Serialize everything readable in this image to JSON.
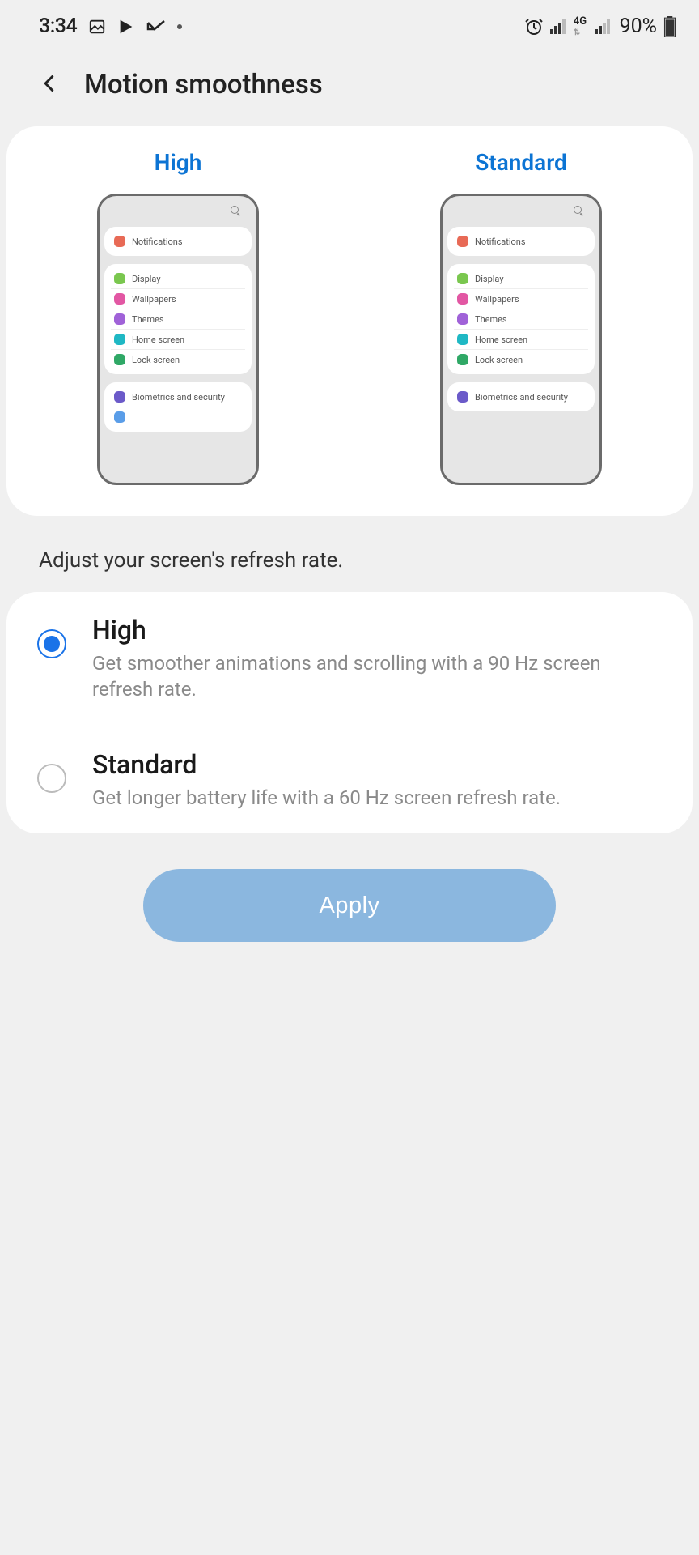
{
  "status": {
    "time": "3:34",
    "network_label": "4G",
    "battery_pct": "90%"
  },
  "header": {
    "title": "Motion smoothness"
  },
  "preview": {
    "high_label": "High",
    "standard_label": "Standard",
    "mock_items": {
      "notifications": "Notifications",
      "display": "Display",
      "wallpapers": "Wallpapers",
      "themes": "Themes",
      "home": "Home screen",
      "lock": "Lock screen",
      "biometrics": "Biometrics and security"
    }
  },
  "description": "Adjust your screen's refresh rate.",
  "options": {
    "high": {
      "title": "High",
      "desc": "Get smoother animations and scrolling with a 90 Hz screen refresh rate.",
      "selected": true
    },
    "standard": {
      "title": "Standard",
      "desc": "Get longer battery life with a 60 Hz screen refresh rate.",
      "selected": false
    }
  },
  "apply_label": "Apply"
}
